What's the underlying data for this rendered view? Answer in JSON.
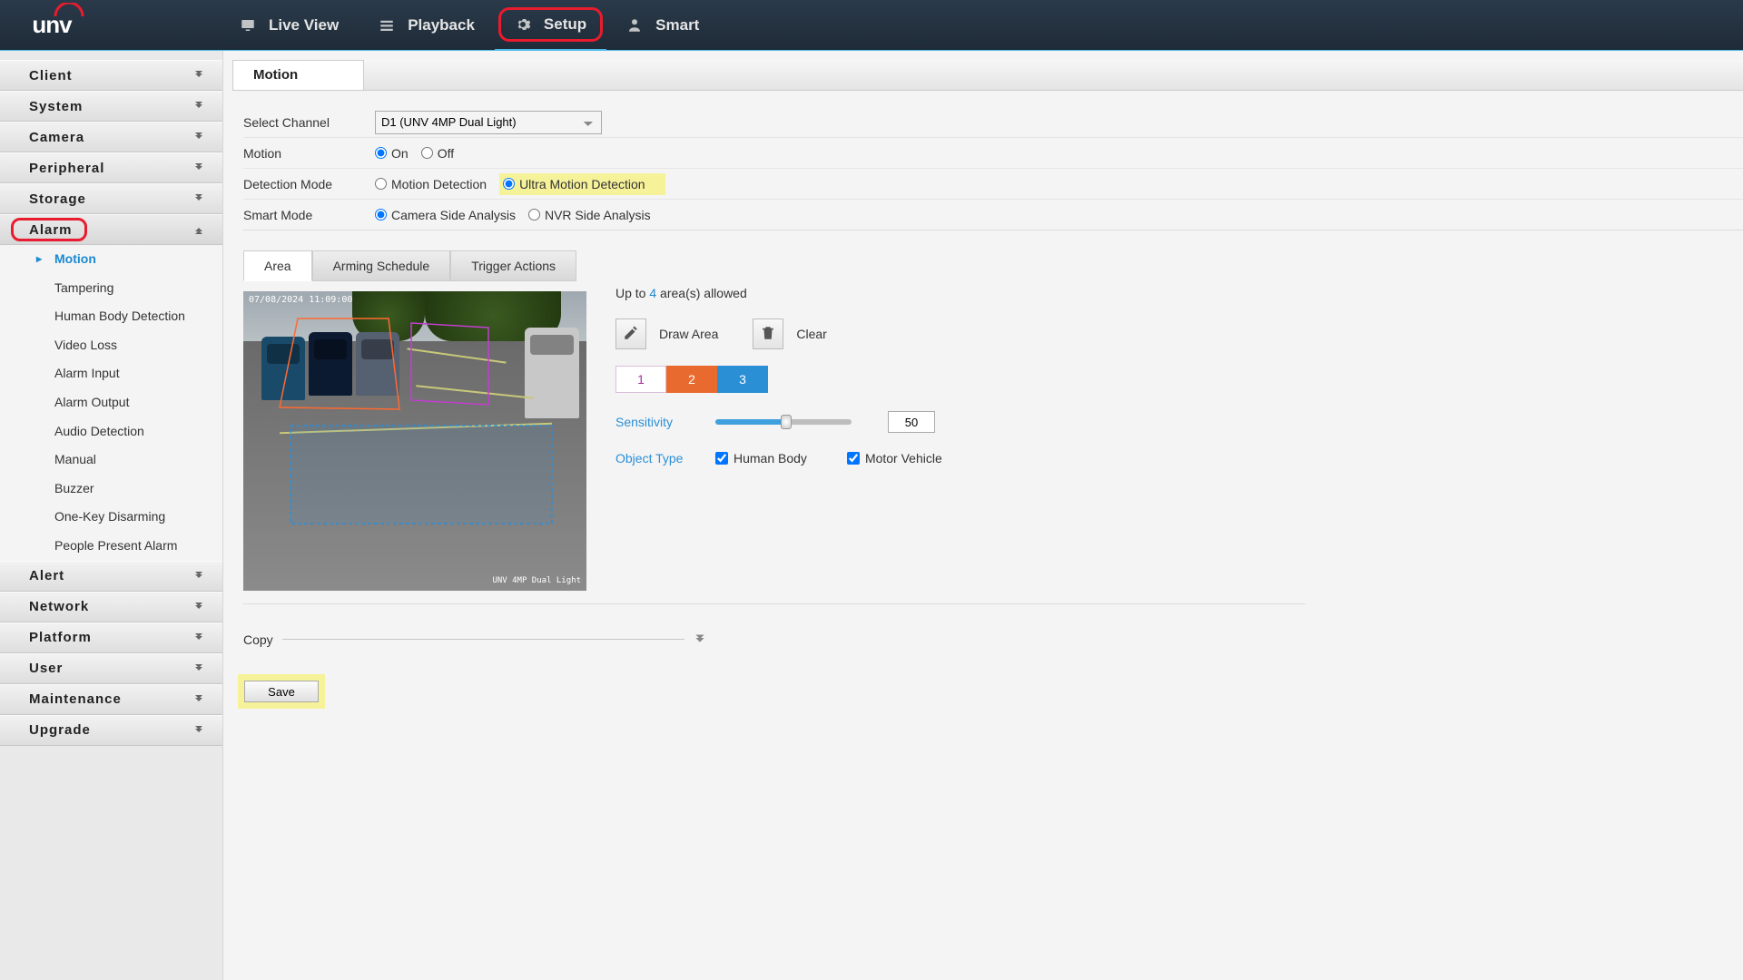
{
  "brand": "unv",
  "nav": {
    "items": [
      {
        "label": "Live View",
        "icon": "monitor"
      },
      {
        "label": "Playback",
        "icon": "list"
      },
      {
        "label": "Setup",
        "icon": "gear",
        "active": true,
        "highlight": true
      },
      {
        "label": "Smart",
        "icon": "person"
      }
    ]
  },
  "sidebar": {
    "items": [
      {
        "label": "Client"
      },
      {
        "label": "System"
      },
      {
        "label": "Camera"
      },
      {
        "label": "Peripheral"
      },
      {
        "label": "Storage"
      },
      {
        "label": "Alarm",
        "expanded": true,
        "highlight": true,
        "children": [
          {
            "label": "Motion",
            "active": true
          },
          {
            "label": "Tampering"
          },
          {
            "label": "Human Body Detection"
          },
          {
            "label": "Video Loss"
          },
          {
            "label": "Alarm Input"
          },
          {
            "label": "Alarm Output"
          },
          {
            "label": "Audio Detection"
          },
          {
            "label": "Manual"
          },
          {
            "label": "Buzzer"
          },
          {
            "label": "One-Key Disarming"
          },
          {
            "label": "People Present Alarm"
          }
        ]
      },
      {
        "label": "Alert"
      },
      {
        "label": "Network"
      },
      {
        "label": "Platform"
      },
      {
        "label": "User"
      },
      {
        "label": "Maintenance"
      },
      {
        "label": "Upgrade"
      }
    ]
  },
  "page": {
    "title": "Motion",
    "channel_label": "Select Channel",
    "channel_value": "D1 (UNV 4MP Dual Light)",
    "motion_label": "Motion",
    "motion_on": "On",
    "motion_off": "Off",
    "detmode_label": "Detection Mode",
    "detmode_a": "Motion Detection",
    "detmode_b": "Ultra Motion Detection",
    "smart_label": "Smart Mode",
    "smart_a": "Camera Side Analysis",
    "smart_b": "NVR Side Analysis",
    "subtabs": [
      "Area",
      "Arming Schedule",
      "Trigger Actions"
    ],
    "area": {
      "allow_pre": "Up to ",
      "allow_n": "4",
      "allow_post": " area(s) allowed",
      "draw": "Draw Area",
      "clear": "Clear",
      "zones": [
        "1",
        "2",
        "3"
      ],
      "sens_label": "Sensitivity",
      "sens_value": "50",
      "obj_label": "Object Type",
      "obj_a": "Human Body",
      "obj_b": "Motor Vehicle",
      "cam_ts": "07/08/2024 11:09:00",
      "cam_wm": "UNV 4MP Dual Light"
    },
    "copy": "Copy",
    "save": "Save"
  }
}
